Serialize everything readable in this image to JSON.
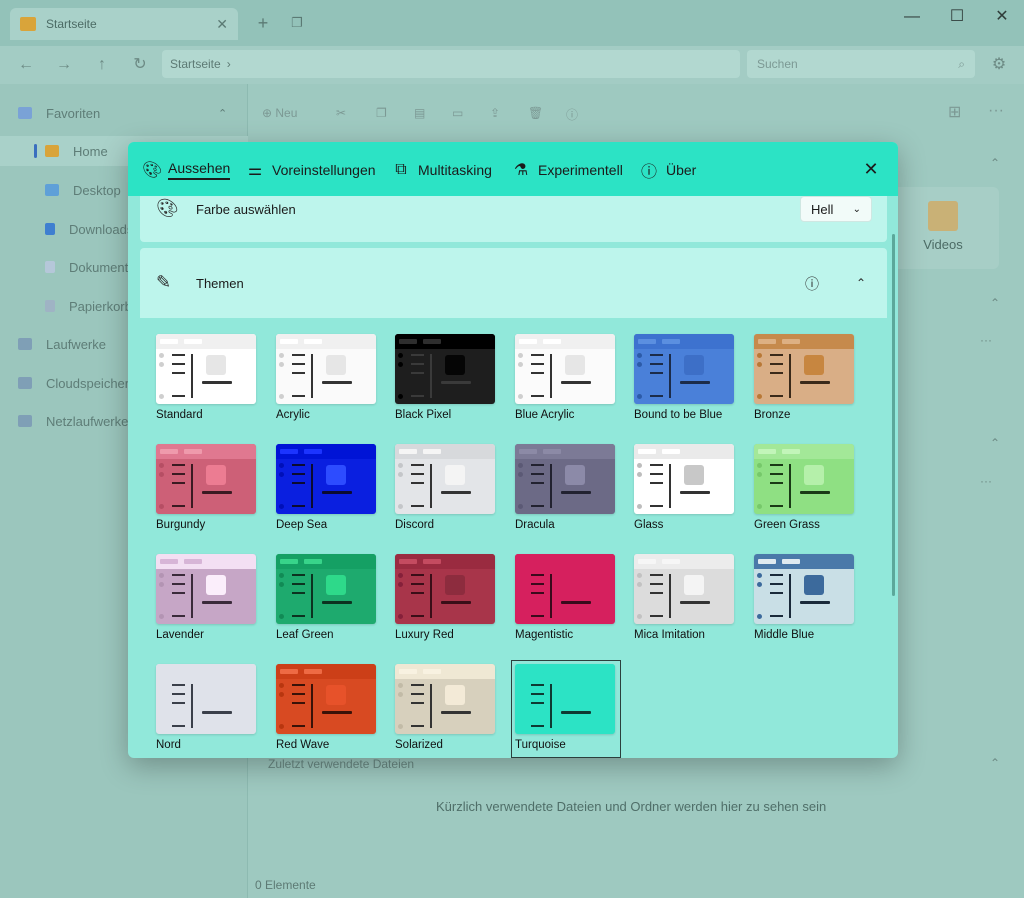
{
  "window": {
    "tab_title": "Startseite",
    "breadcrumb": "Startseite",
    "search_placeholder": "Suchen"
  },
  "toolbar": {
    "new_label": "Neu"
  },
  "sidebar": {
    "items": [
      {
        "label": "Favoriten"
      },
      {
        "label": "Home"
      },
      {
        "label": "Desktop"
      },
      {
        "label": "Downloads"
      },
      {
        "label": "Dokumente"
      },
      {
        "label": "Papierkorb"
      },
      {
        "label": "Laufwerke"
      },
      {
        "label": "Cloudspeicher"
      },
      {
        "label": "Netzlaufwerke"
      }
    ]
  },
  "main": {
    "videos_label": "Videos",
    "recent_header": "Zuletzt verwendete Dateien",
    "recent_empty": "Kürzlich verwendete Dateien und Ordner werden hier zu sehen sein",
    "status": "0 Elemente"
  },
  "dialog": {
    "tabs": [
      {
        "label": "Aussehen",
        "icon": "palette-icon"
      },
      {
        "label": "Voreinstellungen",
        "icon": "sliders-icon"
      },
      {
        "label": "Multitasking",
        "icon": "multitasking-icon"
      },
      {
        "label": "Experimentell",
        "icon": "flask-icon"
      },
      {
        "label": "Über",
        "icon": "info-icon"
      }
    ],
    "color_label": "Farbe auswählen",
    "color_value": "Hell",
    "themes_label": "Themen",
    "themes": [
      {
        "name": "Standard",
        "bg": "#ffffff",
        "bar": "#f0f0f0",
        "fg": "#333333",
        "sq": "#e6e6e6",
        "dot": "#cfcfcf"
      },
      {
        "name": "Acrylic",
        "bg": "#fafafa",
        "bar": "#f0f0f0",
        "fg": "#333333",
        "sq": "#e6e6e6",
        "dot": "#cfcfcf"
      },
      {
        "name": "Black Pixel",
        "bg": "#1e1e1e",
        "bar": "#000000",
        "fg": "#3a3a3a",
        "sq": "#050505",
        "dot": "#000000",
        "pill": "#2e2e2e"
      },
      {
        "name": "Blue Acrylic",
        "bg": "#fbfbfb",
        "bar": "#f0f0f0",
        "fg": "#333333",
        "sq": "#e6e6e6",
        "dot": "#cfcfcf"
      },
      {
        "name": "Bound to be Blue",
        "bg": "#4a80d9",
        "bar": "#3d72cf",
        "fg": "#1c2c4a",
        "sq": "#3d6fc7",
        "dot": "#2c5aa8",
        "pill": "#5b8fe0"
      },
      {
        "name": "Bronze",
        "bg": "#d9ae86",
        "bar": "#c68a4c",
        "fg": "#3a2a1a",
        "sq": "#c78640",
        "dot": "#b87836",
        "pill": "#ddb083"
      },
      {
        "name": "Burgundy",
        "bg": "#cd6077",
        "bar": "#e07890",
        "fg": "#3a1a22",
        "sq": "#ec7c92",
        "dot": "#b64e64",
        "pill": "#ef9aac"
      },
      {
        "name": "Deep Sea",
        "bg": "#0a1fe0",
        "bar": "#0014d6",
        "fg": "#0b0b30",
        "sq": "#2d4cff",
        "dot": "#0010b8",
        "pill": "#1c34ff"
      },
      {
        "name": "Discord",
        "bg": "#e3e5e8",
        "bar": "#d7d9dc",
        "fg": "#333333",
        "sq": "#f4f4f4",
        "dot": "#c4c6c9",
        "pill": "#f5f5f5"
      },
      {
        "name": "Dracula",
        "bg": "#6c6a86",
        "bar": "#7c7a96",
        "fg": "#222230",
        "sq": "#8c8aa8",
        "dot": "#5b5975",
        "pill": "#8c8aa6"
      },
      {
        "name": "Glass",
        "bg": "#ffffff",
        "bar": "#eaeaea",
        "fg": "#333333",
        "sq": "#c8c8c8",
        "dot": "#bdbdbd",
        "pill": "#ffffff"
      },
      {
        "name": "Green Grass",
        "bg": "#8fe083",
        "bar": "#a3e898",
        "fg": "#1a3a16",
        "sq": "#b5f0aa",
        "dot": "#76c86a",
        "pill": "#c2f5b9"
      },
      {
        "name": "Lavender",
        "bg": "#c6a6c6",
        "bar": "#f3dff3",
        "fg": "#3a2a3a",
        "sq": "#fbeefb",
        "dot": "#b394b3",
        "pill": "#d7b5d7"
      },
      {
        "name": "Leaf Green",
        "bg": "#1eaa6e",
        "bar": "#15a064",
        "fg": "#0c3220",
        "sq": "#2ed98a",
        "dot": "#118a55",
        "pill": "#38d48a"
      },
      {
        "name": "Luxury Red",
        "bg": "#a8354a",
        "bar": "#9a2b40",
        "fg": "#3a0e18",
        "sq": "#8d2c3e",
        "dot": "#85203a",
        "pill": "#c44b60"
      },
      {
        "name": "Magentistic",
        "bg": "#d6205e",
        "bar": "#d6205e",
        "fg": "#3a0a1c",
        "sq": "#d6205e",
        "dot": "#d6205e",
        "pill": "#d6205e"
      },
      {
        "name": "Mica Imitation",
        "bg": "#dcdcdc",
        "bar": "#ececec",
        "fg": "#333333",
        "sq": "#f4f4f4",
        "dot": "#c2c2c2",
        "pill": "#f6f6f6"
      },
      {
        "name": "Middle Blue",
        "bg": "#c9dfe6",
        "bar": "#4a79a9",
        "fg": "#1a2a3a",
        "sq": "#3c6a9c",
        "dot": "#3c6a9c",
        "pill": "#dfeaf0"
      },
      {
        "name": "Nord",
        "bg": "#dfe2ea",
        "bar": "#dfe2ea",
        "fg": "#3a3f4a",
        "sq": "#dfe2ea",
        "dot": "#dfe2ea",
        "pill": "#dfe2ea"
      },
      {
        "name": "Red Wave",
        "bg": "#d84a22",
        "bar": "#cc3f18",
        "fg": "#3a1208",
        "sq": "#e7522a",
        "dot": "#b8360f",
        "pill": "#ee6a44"
      },
      {
        "name": "Solarized",
        "bg": "#d7d0bd",
        "bar": "#efe8d4",
        "fg": "#333333",
        "sq": "#f3ead7",
        "dot": "#c2bba7",
        "pill": "#f8f2e1"
      },
      {
        "name": "Turquoise",
        "bg": "#2ce3c5",
        "bar": "#2ce3c5",
        "fg": "#0e3a33",
        "sq": "#2ce3c5",
        "dot": "#2ce3c5",
        "pill": "#2ce3c5"
      }
    ],
    "selected_theme": "Turquoise"
  }
}
